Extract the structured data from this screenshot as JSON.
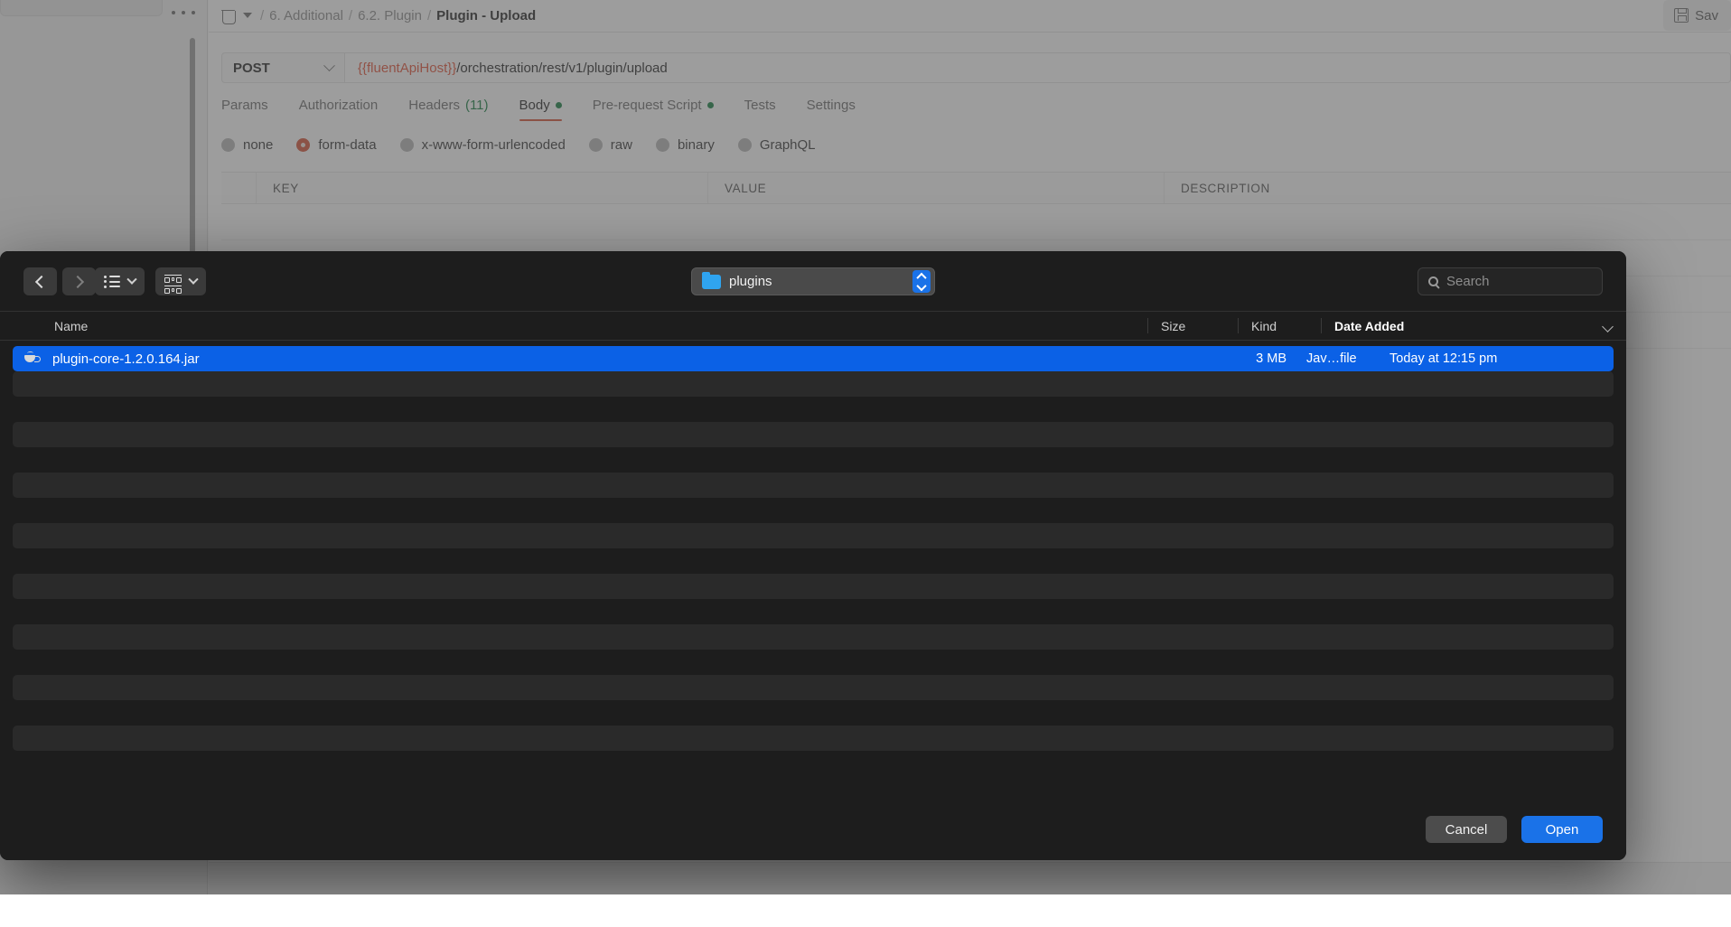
{
  "app": {
    "breadcrumb": {
      "collection_icon": "trash-icon",
      "caret_icon": "caret-down-icon",
      "separator": "/",
      "items": [
        "6. Additional",
        "6.2. Plugin"
      ],
      "current": "Plugin - Upload"
    },
    "save_button": {
      "label": "Sav",
      "icon": "floppy-disk-icon"
    },
    "overflow_menu": "ellipsis-icon",
    "request": {
      "method": "POST",
      "method_chevron": "chevron-down-icon",
      "url_variable": "{{fluentApiHost}}",
      "url_path": "/orchestration/rest/v1/plugin/upload"
    },
    "tabs": [
      {
        "label": "Params",
        "active": false,
        "count": "",
        "dot": false
      },
      {
        "label": "Authorization",
        "active": false,
        "count": "",
        "dot": false
      },
      {
        "label": "Headers",
        "active": false,
        "count": "(11)",
        "dot": false
      },
      {
        "label": "Body",
        "active": true,
        "count": "",
        "dot": true
      },
      {
        "label": "Pre-request Script",
        "active": false,
        "count": "",
        "dot": true
      },
      {
        "label": "Tests",
        "active": false,
        "count": "",
        "dot": false
      },
      {
        "label": "Settings",
        "active": false,
        "count": "",
        "dot": false
      }
    ],
    "body_types": [
      {
        "label": "none",
        "selected": false
      },
      {
        "label": "form-data",
        "selected": true
      },
      {
        "label": "x-www-form-urlencoded",
        "selected": false
      },
      {
        "label": "raw",
        "selected": false
      },
      {
        "label": "binary",
        "selected": false
      },
      {
        "label": "GraphQL",
        "selected": false
      }
    ],
    "table_headers": [
      "KEY",
      "VALUE",
      "DESCRIPTION"
    ],
    "colors": {
      "accent": "#d2563a",
      "variable": "#e0563c",
      "ok": "#1a7f44"
    }
  },
  "dialog": {
    "nav": {
      "back": "chevron-left-icon",
      "forward": "chevron-right-icon",
      "back_enabled": true,
      "forward_enabled": false
    },
    "view_buttons": [
      {
        "icon": "list-view-icon",
        "chevron": "chevron-down-icon"
      },
      {
        "icon": "group-by-icon",
        "chevron": "chevron-down-icon"
      }
    ],
    "path": {
      "folder_icon": "folder-icon",
      "label": "plugins",
      "stepper_icon": "updown-stepper-icon"
    },
    "search": {
      "icon": "search-icon",
      "placeholder": "Search",
      "value": ""
    },
    "columns": [
      {
        "label": "Name",
        "sorted": false
      },
      {
        "label": "Size",
        "sorted": false
      },
      {
        "label": "Kind",
        "sorted": false
      },
      {
        "label": "Date Added",
        "sorted": true
      }
    ],
    "column_chevron": "chevron-down-icon",
    "files": [
      {
        "icon": "java-file-icon",
        "name": "plugin-core-1.2.0.164.jar",
        "size": "3 MB",
        "kind": "Jav…file",
        "date_added": "Today at 12:15 pm",
        "selected": true
      }
    ],
    "empty_row_count": 8,
    "buttons": {
      "cancel": "Cancel",
      "open": "Open"
    },
    "colors": {
      "selection": "#0b61e6",
      "primary_button": "#1a72e8",
      "background": "#1d1d1d"
    }
  }
}
